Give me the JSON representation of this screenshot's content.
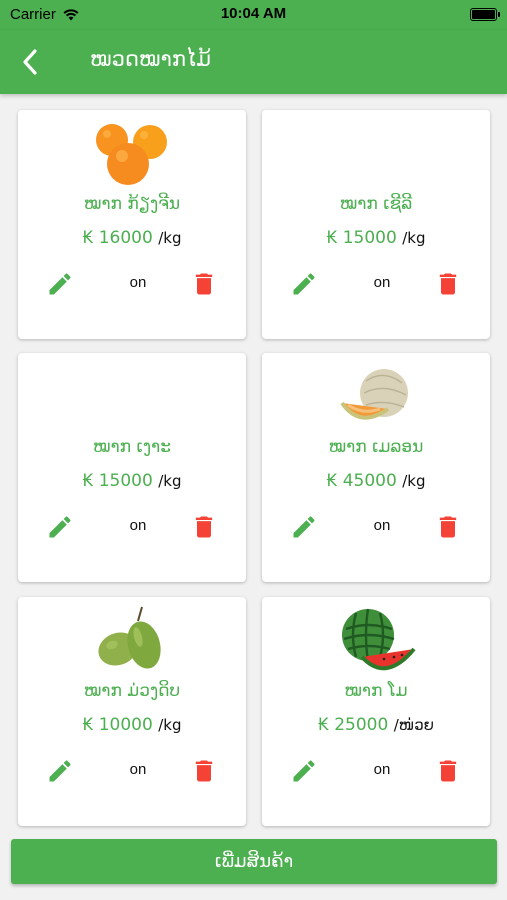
{
  "status_bar": {
    "carrier": "Carrier",
    "time": "10:04 AM"
  },
  "app_bar": {
    "title": "ໝວດໝາກໄມ້"
  },
  "products": [
    {
      "name": "ໝາກ ກ້ຽງຈີນ",
      "currency": "₭",
      "price": "16000",
      "unit": "/kg",
      "status": "on",
      "image": "orange"
    },
    {
      "name": "ໝາກ ເຊີລີ",
      "currency": "₭",
      "price": "15000",
      "unit": "/kg",
      "status": "on",
      "image": ""
    },
    {
      "name": "ໝາກ ເງາະ",
      "currency": "₭",
      "price": "15000",
      "unit": "/kg",
      "status": "on",
      "image": ""
    },
    {
      "name": "ໝາກ ເມລອນ",
      "currency": "₭",
      "price": "45000",
      "unit": "/kg",
      "status": "on",
      "image": "melon"
    },
    {
      "name": "ໝາກ ມ່ວງດິບ",
      "currency": "₭",
      "price": "10000",
      "unit": "/kg",
      "status": "on",
      "image": "mango"
    },
    {
      "name": "ໝາກ ໂມ",
      "currency": "₭",
      "price": "25000",
      "unit": "/ໜ່ວຍ",
      "status": "on",
      "image": "watermelon"
    }
  ],
  "add_button": {
    "label": "ເພີ່ມສິນຄ້າ"
  },
  "colors": {
    "primary": "#4caf50",
    "delete": "#f44336"
  }
}
